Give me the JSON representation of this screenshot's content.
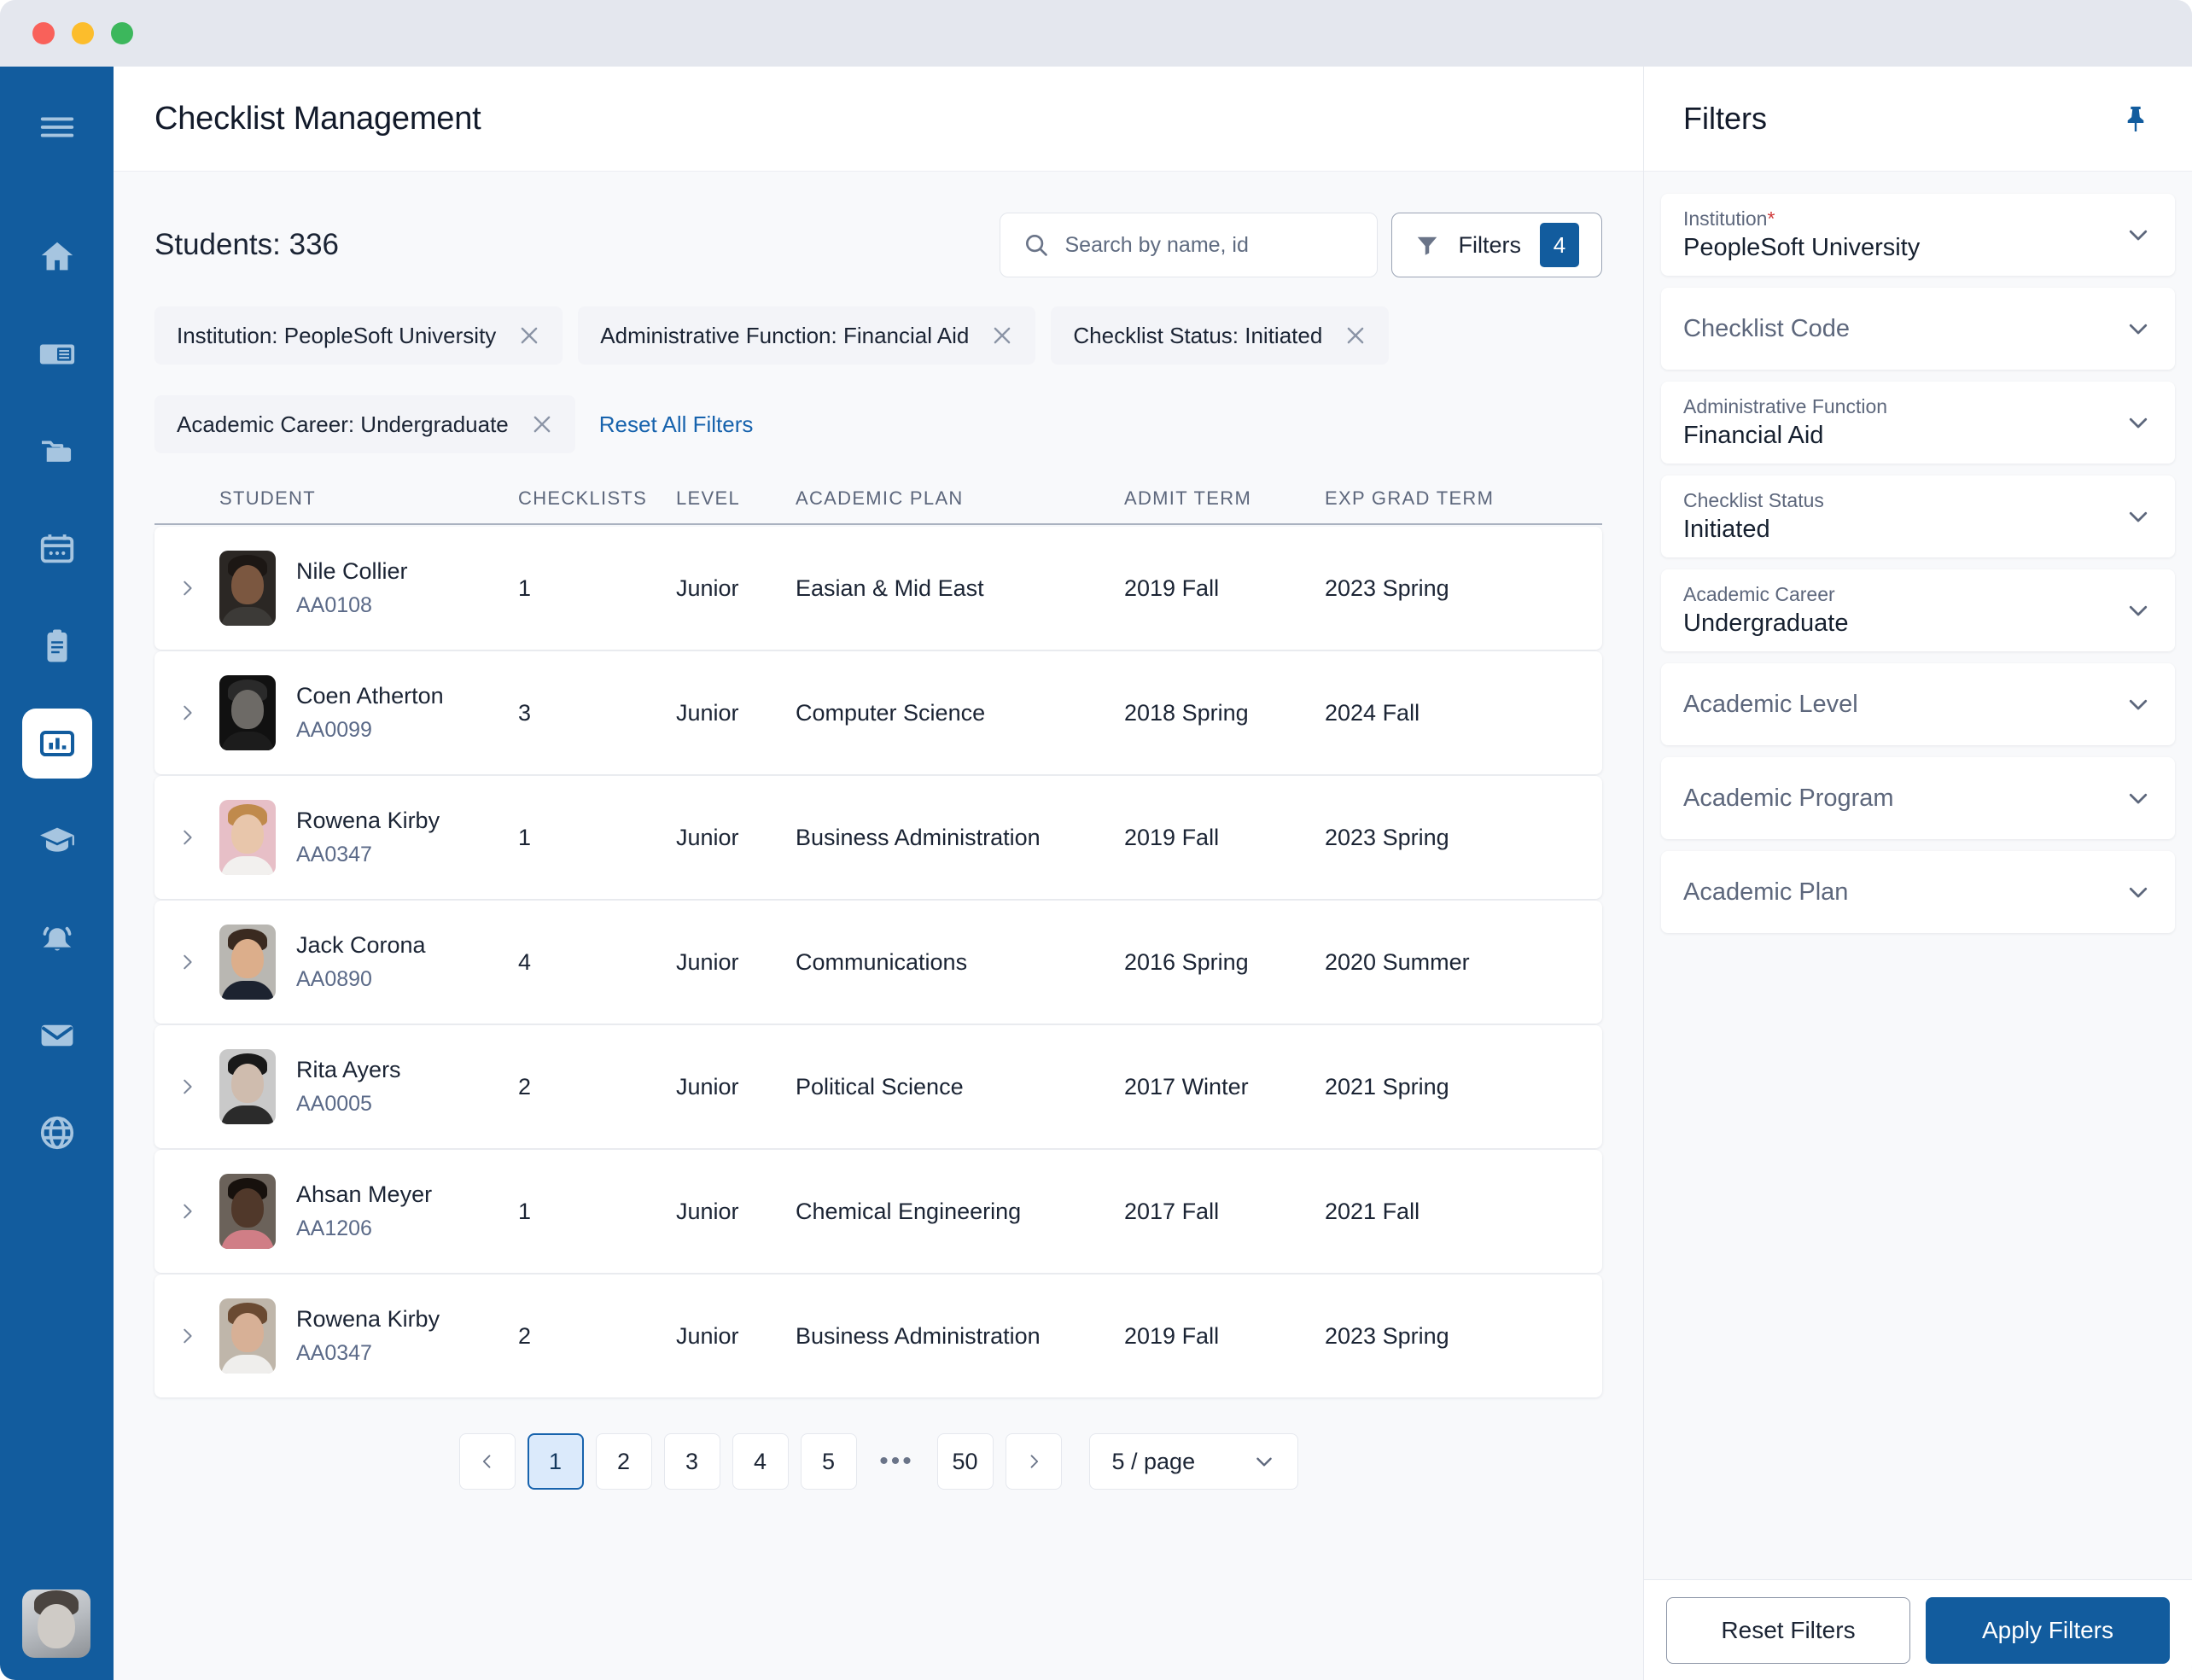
{
  "window": {
    "traffic_lights": [
      "close",
      "minimize",
      "maximize"
    ]
  },
  "sidebar": {
    "items": [
      {
        "icon": "hamburger-menu-icon",
        "name": "menu"
      },
      {
        "icon": "home-icon",
        "name": "home"
      },
      {
        "icon": "id-card-icon",
        "name": "id-card"
      },
      {
        "icon": "folder-icon",
        "name": "folder"
      },
      {
        "icon": "calendar-icon",
        "name": "calendar"
      },
      {
        "icon": "clipboard-icon",
        "name": "clipboard"
      },
      {
        "icon": "bar-chart-icon",
        "name": "reports",
        "active": true
      },
      {
        "icon": "graduation-cap-icon",
        "name": "academics"
      },
      {
        "icon": "bell-icon",
        "name": "notifications"
      },
      {
        "icon": "envelope-icon",
        "name": "messages"
      },
      {
        "icon": "globe-icon",
        "name": "global"
      }
    ]
  },
  "header": {
    "title": "Checklist Management"
  },
  "toolbar": {
    "students_count": "Students: 336",
    "search_placeholder": "Search by name, id",
    "search_value": "",
    "filters_label": "Filters",
    "filters_badge": "4"
  },
  "chips": {
    "items": [
      {
        "label": "Institution: PeopleSoft University"
      },
      {
        "label": "Administrative Function: Financial Aid"
      },
      {
        "label": "Checklist Status: Initiated"
      },
      {
        "label": "Academic Career: Undergraduate"
      }
    ],
    "reset_all_label": "Reset All Filters"
  },
  "table": {
    "columns": [
      "STUDENT",
      "CHECKLISTS",
      "LEVEL",
      "ACADEMIC PLAN",
      "ADMIT TERM",
      "EXP GRAD TERM"
    ],
    "rows": [
      {
        "name": "Nile Collier",
        "id": "AA0108",
        "checklists": "1",
        "level": "Junior",
        "plan": "Easian & Mid East",
        "admit": "2019 Fall",
        "grad": "2023 Spring",
        "avatar": {
          "bg": "#2b2724",
          "skin": "#7b5740",
          "hair": "#1c1714",
          "body": "#3c3a37"
        }
      },
      {
        "name": "Coen Atherton",
        "id": "AA0099",
        "checklists": "3",
        "level": "Junior",
        "plan": "Computer Science",
        "admit": "2018 Spring",
        "grad": "2024 Fall",
        "avatar": {
          "bg": "#111111",
          "skin": "#6d6a66",
          "hair": "#2a2a2a",
          "body": "#1c1c1c"
        }
      },
      {
        "name": "Rowena Kirby",
        "id": "AA0347",
        "checklists": "1",
        "level": "Junior",
        "plan": "Business Administration",
        "admit": "2019 Fall",
        "grad": "2023 Spring",
        "avatar": {
          "bg": "#e7bfc7",
          "skin": "#e8c6ab",
          "hair": "#c08a4c",
          "body": "#f2f0ee"
        }
      },
      {
        "name": "Jack Corona",
        "id": "AA0890",
        "checklists": "4",
        "level": "Junior",
        "plan": "Communications",
        "admit": "2016 Spring",
        "grad": "2020 Summer",
        "avatar": {
          "bg": "#b9b7b2",
          "skin": "#dcae8b",
          "hair": "#3a2a20",
          "body": "#1d2330"
        }
      },
      {
        "name": "Rita Ayers",
        "id": "AA0005",
        "checklists": "2",
        "level": "Junior",
        "plan": "Political Science",
        "admit": "2017 Winter",
        "grad": "2021 Spring",
        "avatar": {
          "bg": "#c9c9c9",
          "skin": "#cfbcae",
          "hair": "#191919",
          "body": "#2b2b2b"
        }
      },
      {
        "name": "Ahsan Meyer",
        "id": "AA1206",
        "checklists": "1",
        "level": "Junior",
        "plan": "Chemical Engineering",
        "admit": "2017 Fall",
        "grad": "2021 Fall",
        "avatar": {
          "bg": "#6b625a",
          "skin": "#50382a",
          "hair": "#17110d",
          "body": "#d07e86"
        }
      },
      {
        "name": "Rowena Kirby",
        "id": "AA0347",
        "checklists": "2",
        "level": "Junior",
        "plan": "Business Administration",
        "admit": "2019 Fall",
        "grad": "2023 Spring",
        "avatar": {
          "bg": "#bfb6aa",
          "skin": "#d7b096",
          "hair": "#6a4a32",
          "body": "#efeeec"
        }
      }
    ]
  },
  "pagination": {
    "prev": "‹",
    "pages": [
      "1",
      "2",
      "3",
      "4",
      "5"
    ],
    "ellipsis": "•••",
    "last_page": "50",
    "next": "›",
    "active_page": "1",
    "page_size": "5 / page"
  },
  "filters_panel": {
    "title": "Filters",
    "fields": [
      {
        "label": "Institution",
        "required": true,
        "value": "PeopleSoft University",
        "placeholder": ""
      },
      {
        "label": "",
        "required": false,
        "value": "",
        "placeholder": "Checklist Code"
      },
      {
        "label": "Administrative Function",
        "required": false,
        "value": "Financial Aid",
        "placeholder": ""
      },
      {
        "label": "Checklist Status",
        "required": false,
        "value": "Initiated",
        "placeholder": ""
      },
      {
        "label": "Academic Career",
        "required": false,
        "value": "Undergraduate",
        "placeholder": ""
      },
      {
        "label": "",
        "required": false,
        "value": "",
        "placeholder": "Academic Level"
      },
      {
        "label": "",
        "required": false,
        "value": "",
        "placeholder": "Academic Program"
      },
      {
        "label": "",
        "required": false,
        "value": "",
        "placeholder": "Academic Plan"
      }
    ],
    "reset_label": "Reset Filters",
    "apply_label": "Apply Filters"
  },
  "colors": {
    "brand_blue": "#125c9e",
    "link_blue": "#1763ad",
    "active_page_bg": "#dbeafb",
    "chip_bg": "#f3f4f8",
    "required_red": "#d03a3a"
  }
}
